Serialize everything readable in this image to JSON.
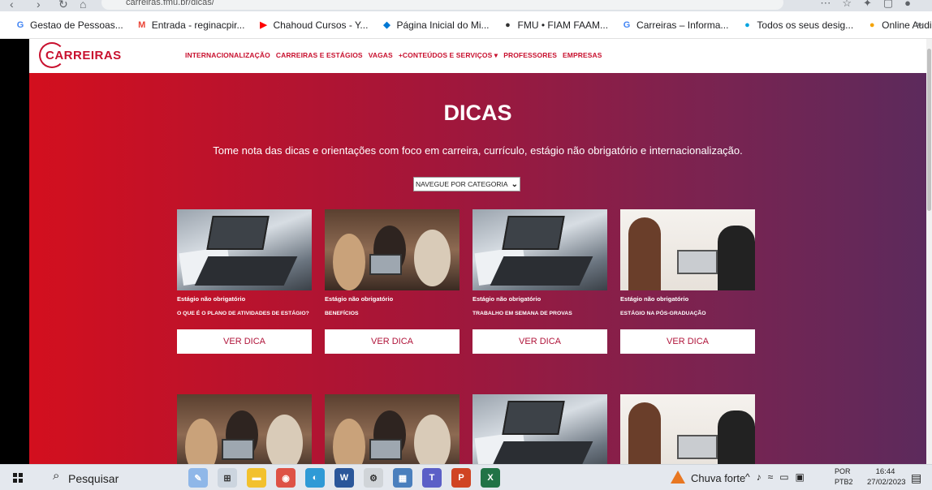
{
  "browser": {
    "url": "carreiras.fmu.br/dicas/",
    "bookmarks": [
      {
        "icon": "G",
        "label": "Gestao de Pessoas...",
        "color": "#4285f4"
      },
      {
        "icon": "M",
        "label": "Entrada - reginacpir...",
        "color": "#ea4335"
      },
      {
        "icon": "▶",
        "label": "Chahoud Cursos - Y...",
        "color": "#ff0000"
      },
      {
        "icon": "◆",
        "label": "Página Inicial do Mi...",
        "color": "#0078d4"
      },
      {
        "icon": "●",
        "label": "FMU • FIAM FAAM...",
        "color": "#333333"
      },
      {
        "icon": "G",
        "label": "Carreiras – Informa...",
        "color": "#4285f4"
      },
      {
        "icon": "●",
        "label": "Todos os seus desig...",
        "color": "#00a3e0"
      },
      {
        "icon": "●",
        "label": "Online Audio Conv...",
        "color": "#f4a300"
      }
    ],
    "more": "»"
  },
  "site": {
    "logo": "CARREIRAS",
    "nav": [
      "INTERNACIONALIZAÇÃO",
      "CARREIRAS E ESTÁGIOS",
      "VAGAS",
      "+CONTEÚDOS E SERVIÇOS ▾",
      "PROFESSORES",
      "EMPRESAS"
    ]
  },
  "hero": {
    "title": "DICAS",
    "subtitle": "Tome nota das dicas e orientações com foco em carreira, currículo, estágio não obrigatório e internacionalização.",
    "select_label": "NAVEGUE POR CATEGORIA"
  },
  "cards": [
    {
      "category": "Estágio não obrigatório",
      "title": "O QUE É O PLANO DE ATIVIDADES DE ESTÁGIO?",
      "button": "VER DICA",
      "image": "laptop"
    },
    {
      "category": "Estágio não obrigatório",
      "title": "BENEFÍCIOS",
      "button": "VER DICA",
      "image": "meeting"
    },
    {
      "category": "Estágio não obrigatório",
      "title": "TRABALHO EM SEMANA DE PROVAS",
      "button": "VER DICA",
      "image": "laptop"
    },
    {
      "category": "Estágio não obrigatório",
      "title": "ESTÁGIO NA PÓS-GRADUAÇÃO",
      "button": "VER DICA",
      "image": "desk"
    }
  ],
  "taskbar": {
    "search": "Pesquisar",
    "weather": "Chuva forte",
    "lang_top": "POR",
    "lang_bottom": "PTB2",
    "time": "16:44",
    "date": "27/02/2023"
  }
}
